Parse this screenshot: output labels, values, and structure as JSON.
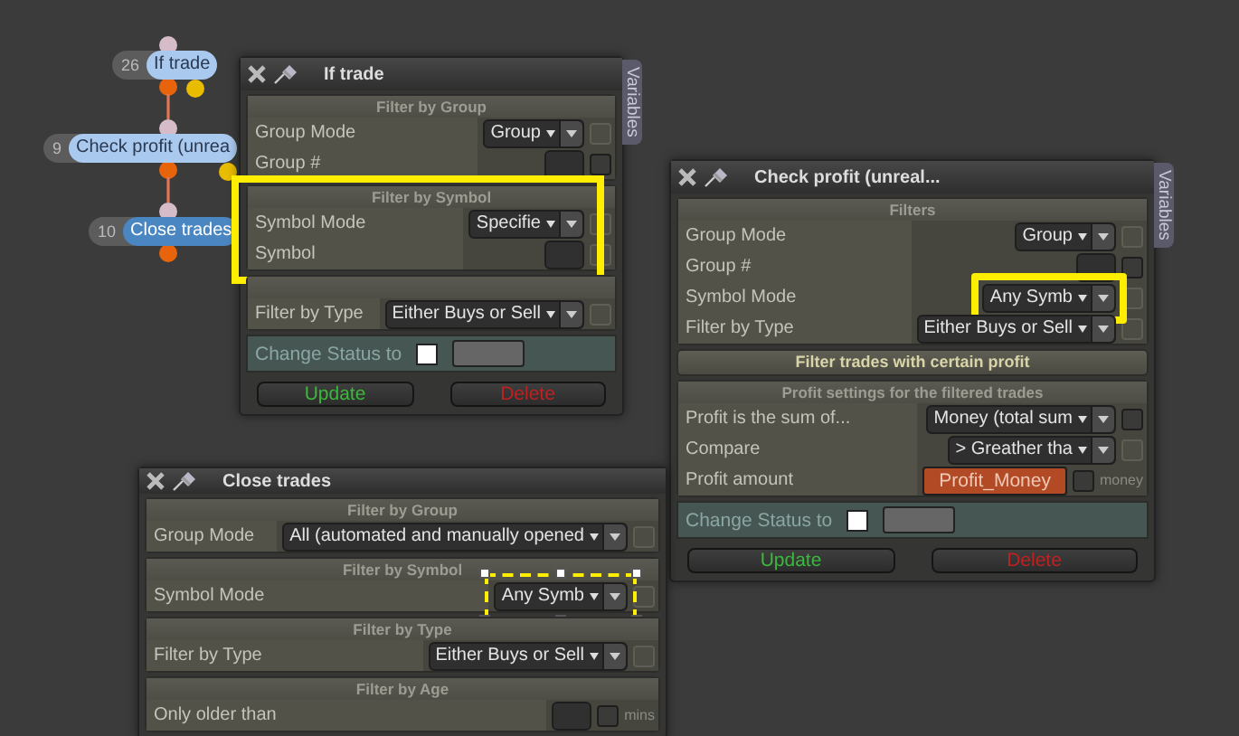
{
  "nodes": [
    {
      "number": "26",
      "label": "If trade",
      "selected": false,
      "second_output": true
    },
    {
      "number": "9",
      "label": "Check profit (unrea",
      "selected": false,
      "second_output": true
    },
    {
      "number": "10",
      "label": "Close trades",
      "selected": true,
      "second_output": false
    }
  ],
  "windows": [
    {
      "title": "If trade",
      "variables_tab": "Variables",
      "sections": [
        {
          "kind": "group",
          "header": "Filter by Group",
          "highlighted": false,
          "rows": [
            {
              "label": "Group Mode",
              "kind": "dropdown",
              "value": "Group",
              "checkbox_disabled": true,
              "highlighted": false,
              "framed": false
            },
            {
              "label": "Group #",
              "kind": "number",
              "checkbox_disabled": false,
              "highlighted": false,
              "framed": false
            }
          ]
        },
        {
          "kind": "group",
          "header": "Filter by Symbol",
          "highlighted": true,
          "rows": [
            {
              "label": "Symbol Mode",
              "kind": "dropdown",
              "value": "Specifie",
              "checkbox_disabled": true,
              "highlighted": false,
              "framed": false
            },
            {
              "label": "Symbol",
              "kind": "number",
              "checkbox_disabled": true,
              "highlighted": false,
              "framed": false
            }
          ]
        },
        {
          "kind": "group",
          "highlighted": false,
          "rows": [
            {
              "label": "Filter by Type",
              "kind": "dropdown",
              "value": "Either Buys or Sell",
              "checkbox_disabled": true,
              "highlighted": false,
              "framed": false
            }
          ]
        }
      ],
      "change_status": "Change Status to",
      "status_checked": false,
      "buttons": [
        {
          "label": "Update",
          "kind": "confirm"
        },
        {
          "label": "Delete",
          "kind": "danger"
        }
      ]
    },
    {
      "title": "Check profit (unreal...",
      "variables_tab": "Variables",
      "sections": [
        {
          "kind": "group",
          "header": "Filters",
          "highlighted": false,
          "rows": [
            {
              "label": "Group Mode",
              "kind": "dropdown",
              "value": "Group",
              "checkbox_disabled": true,
              "highlighted": false,
              "framed": false
            },
            {
              "label": "Group #",
              "kind": "number",
              "checkbox_disabled": false,
              "highlighted": false,
              "framed": false
            },
            {
              "label": "Symbol Mode",
              "kind": "dropdown",
              "value": "Any Symb",
              "checkbox_disabled": true,
              "highlighted": true,
              "framed": false
            },
            {
              "label": "Filter by Type",
              "kind": "dropdown",
              "value": "Either Buys or Sell",
              "checkbox_disabled": true,
              "highlighted": false,
              "framed": false
            }
          ]
        },
        {
          "kind": "banner",
          "header": "Filter trades with certain profit",
          "highlighted": false
        },
        {
          "kind": "group",
          "header": "Profit settings for the filtered trades",
          "highlighted": false,
          "rows": [
            {
              "label": "Profit is the sum of...",
              "kind": "dropdown",
              "value": "Money (total sum",
              "checkbox_disabled": false,
              "highlighted": false,
              "framed": false
            },
            {
              "label": "Compare",
              "kind": "dropdown",
              "value": "> Greather tha",
              "checkbox_disabled": true,
              "highlighted": false,
              "framed": false
            },
            {
              "label": "Profit amount",
              "kind": "variable",
              "value": "Profit_Money",
              "checkbox_disabled": false,
              "unit": "money",
              "highlighted": false,
              "framed": false
            }
          ]
        }
      ],
      "change_status": "Change Status to",
      "status_checked": false,
      "buttons": [
        {
          "label": "Update",
          "kind": "confirm"
        },
        {
          "label": "Delete",
          "kind": "danger"
        }
      ]
    },
    {
      "title": "Close trades",
      "sections": [
        {
          "kind": "group",
          "header": "Filter by Group",
          "highlighted": false,
          "rows": [
            {
              "label": "Group Mode",
              "kind": "dropdown",
              "value": "All (automated and manually opened",
              "checkbox_disabled": true,
              "highlighted": false,
              "framed": false
            }
          ]
        },
        {
          "kind": "group",
          "header": "Filter by Symbol",
          "highlighted": false,
          "rows": [
            {
              "label": "Symbol Mode",
              "kind": "dropdown",
              "value": "Any Symb",
              "checkbox_disabled": true,
              "highlighted": false,
              "framed": true
            }
          ]
        },
        {
          "kind": "group",
          "header": "Filter by Type",
          "highlighted": false,
          "rows": [
            {
              "label": "Filter by Type",
              "kind": "dropdown",
              "value": "Either Buys or Sell",
              "checkbox_disabled": true,
              "highlighted": false,
              "framed": false
            }
          ]
        },
        {
          "kind": "group",
          "header": "Filter by Age",
          "highlighted": false,
          "rows": [
            {
              "label": "Only older than",
              "kind": "number",
              "checkbox_disabled": false,
              "unit": "mins",
              "highlighted": false,
              "framed": false
            }
          ]
        }
      ]
    }
  ]
}
